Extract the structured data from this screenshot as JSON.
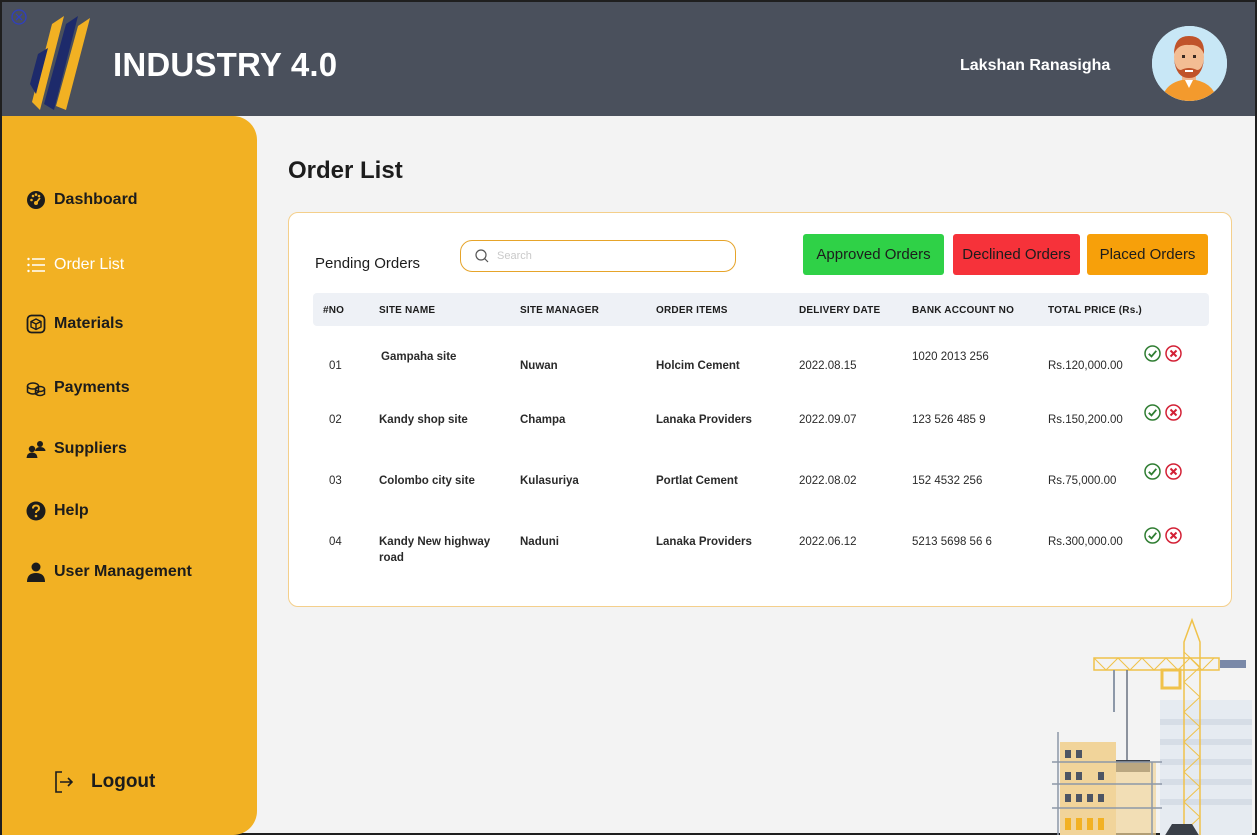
{
  "header": {
    "brand": "INDUSTRY 4.0",
    "user_name": "Lakshan Ranasigha"
  },
  "sidebar": {
    "items": [
      {
        "label": "Dashboard",
        "icon": "speedometer-icon"
      },
      {
        "label": "Order List",
        "icon": "list-icon",
        "active": true
      },
      {
        "label": "Materials",
        "icon": "box-icon"
      },
      {
        "label": "Payments",
        "icon": "coins-icon"
      },
      {
        "label": "Suppliers",
        "icon": "people-icon"
      },
      {
        "label": "Help",
        "icon": "help-icon"
      },
      {
        "label": "User Management",
        "icon": "user-icon"
      }
    ],
    "logout_label": "Logout"
  },
  "main": {
    "title": "Order List",
    "pending_label": "Pending Orders",
    "search_placeholder": "Search",
    "buttons": {
      "approved": "Approved Orders",
      "declined": "Declined Orders",
      "placed": "Placed Orders"
    },
    "colors": {
      "approved": "#2fd147",
      "declined": "#f6323a",
      "placed": "#f7a00a",
      "accent": "#f2b123",
      "header": "#4a505c"
    },
    "table": {
      "columns": [
        "#NO",
        "SITE NAME",
        "SITE MANAGER",
        "ORDER ITEMS",
        "DELIVERY DATE",
        "BANK ACCOUNT NO",
        "TOTAL PRICE (Rs.)"
      ],
      "rows": [
        {
          "no": "01",
          "site": "Gampaha site",
          "manager": "Nuwan",
          "items": "Holcim Cement",
          "date": "2022.08.15",
          "bank": "1020 2013 256",
          "price": "Rs.120,000.00"
        },
        {
          "no": "02",
          "site": "Kandy shop site",
          "manager": "Champa",
          "items": "Lanaka Providers",
          "date": "2022.09.07",
          "bank": "123 526 485 9",
          "price": "Rs.150,200.00"
        },
        {
          "no": "03",
          "site": "Colombo city site",
          "manager": "Kulasuriya",
          "items": "Portlat Cement",
          "date": "2022.08.02",
          "bank": "152 4532 256",
          "price": "Rs.75,000.00"
        },
        {
          "no": "04",
          "site": "Kandy New highway road",
          "manager": "Naduni",
          "items": "Lanaka Providers",
          "date": "2022.06.12",
          "bank": "5213 5698 56 6",
          "price": "Rs.300,000.00"
        }
      ]
    }
  }
}
